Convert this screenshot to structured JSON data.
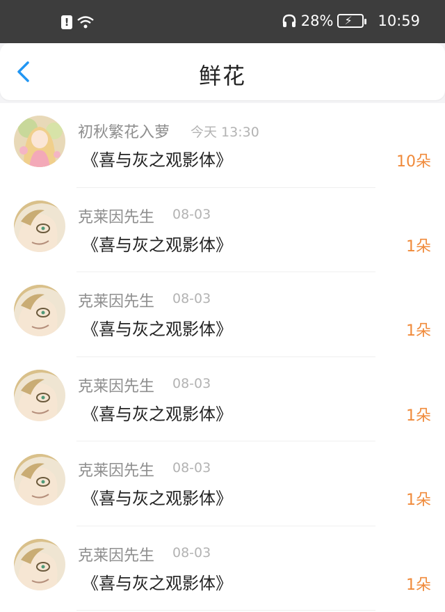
{
  "status_bar": {
    "battery_percent": "28%",
    "time": "10:59",
    "icons": [
      "alert-icon",
      "wifi-icon",
      "headphones-icon",
      "battery-charging-icon"
    ]
  },
  "header": {
    "title": "鲜花",
    "back_icon": "chevron-left-icon"
  },
  "colors": {
    "accent_back": "#2196f3",
    "count_orange": "#f08a3a",
    "status_bar_bg": "#3d3d3d"
  },
  "rows": [
    {
      "name": "初秋繁花入萝",
      "date": "今天 13:30",
      "title": "《喜与灰之观影体》",
      "count": "10朵",
      "avatar": "anime-girl-avatar"
    },
    {
      "name": "克莱因先生",
      "date": "08-03",
      "title": "《喜与灰之观影体》",
      "count": "1朵",
      "avatar": "blond-boy-avatar"
    },
    {
      "name": "克莱因先生",
      "date": "08-03",
      "title": "《喜与灰之观影体》",
      "count": "1朵",
      "avatar": "blond-boy-avatar"
    },
    {
      "name": "克莱因先生",
      "date": "08-03",
      "title": "《喜与灰之观影体》",
      "count": "1朵",
      "avatar": "blond-boy-avatar"
    },
    {
      "name": "克莱因先生",
      "date": "08-03",
      "title": "《喜与灰之观影体》",
      "count": "1朵",
      "avatar": "blond-boy-avatar"
    },
    {
      "name": "克莱因先生",
      "date": "08-03",
      "title": "《喜与灰之观影体》",
      "count": "1朵",
      "avatar": "blond-boy-avatar"
    }
  ]
}
